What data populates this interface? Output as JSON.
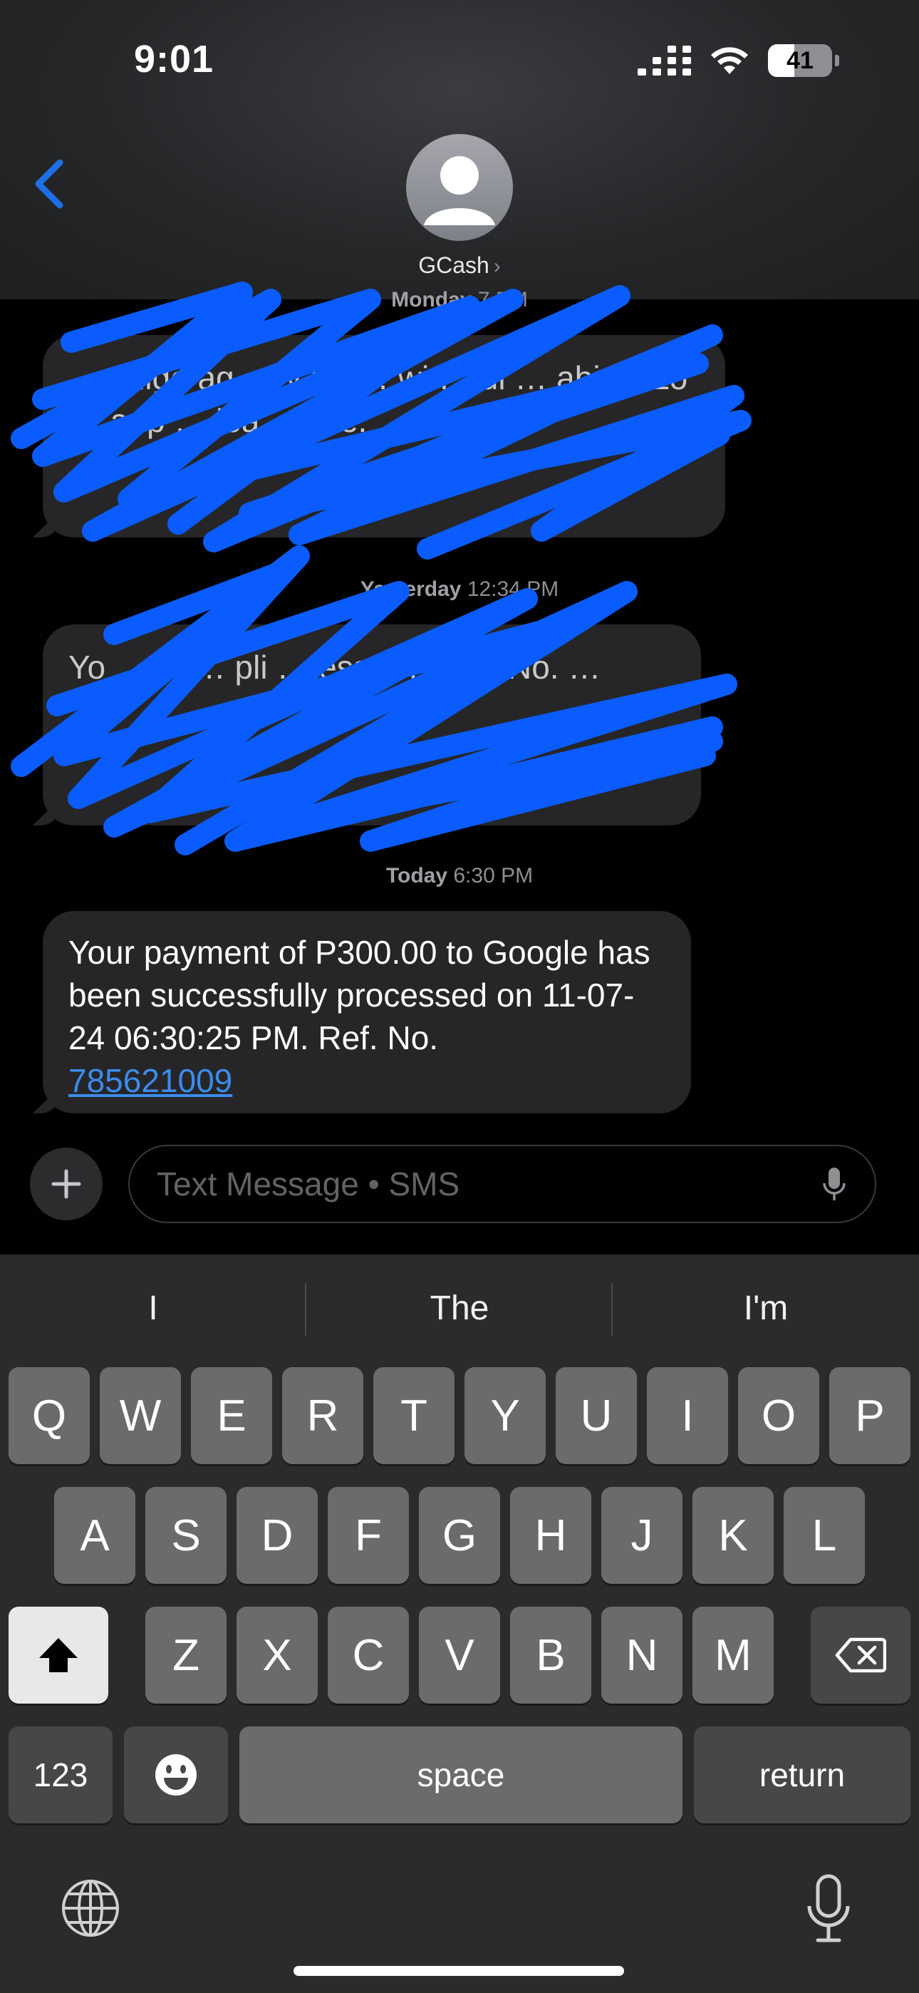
{
  "status_bar": {
    "time": "9:01",
    "battery": "41",
    "battery_level": 0.41
  },
  "header": {
    "contact_name": "GCash",
    "chevron": "›"
  },
  "messages": [
    {
      "timestamp_day": "Monday",
      "timestamp_time": "7 PM",
      "text": "…oblige ag … y pa … wi … ul … abi … Lo … app … lea … ore."
    },
    {
      "timestamp_day": "Yesterday",
      "timestamp_time": "12:34 PM",
      "text": "Yo … of … pli … essa … Ref. No. …"
    },
    {
      "timestamp_day": "Today",
      "timestamp_time": "6:30 PM",
      "text": "Your payment of P300.00 to Google has been successfully processed on 11-07-24 06:30:25 PM. Ref. No.",
      "link": "785621009"
    }
  ],
  "composer": {
    "placeholder": "Text Message • SMS"
  },
  "keyboard": {
    "suggestions": [
      "I",
      "The",
      "I'm"
    ],
    "row1": [
      "Q",
      "W",
      "E",
      "R",
      "T",
      "Y",
      "U",
      "I",
      "O",
      "P"
    ],
    "row2": [
      "A",
      "S",
      "D",
      "F",
      "G",
      "H",
      "J",
      "K",
      "L"
    ],
    "row3": [
      "Z",
      "X",
      "C",
      "V",
      "B",
      "N",
      "M"
    ],
    "numbers_label": "123",
    "space_label": "space",
    "return_label": "return"
  },
  "icons": [
    "back-chevron-icon",
    "avatar-icon",
    "signal-icon",
    "wifi-icon",
    "battery-icon",
    "plus-icon",
    "mic-icon",
    "shift-icon",
    "delete-icon",
    "emoji-icon",
    "globe-icon",
    "dictation-mic-icon"
  ],
  "colors": {
    "accent": "#1e6fe6",
    "link": "#3b8ced",
    "scribble": "#0a5cff"
  }
}
